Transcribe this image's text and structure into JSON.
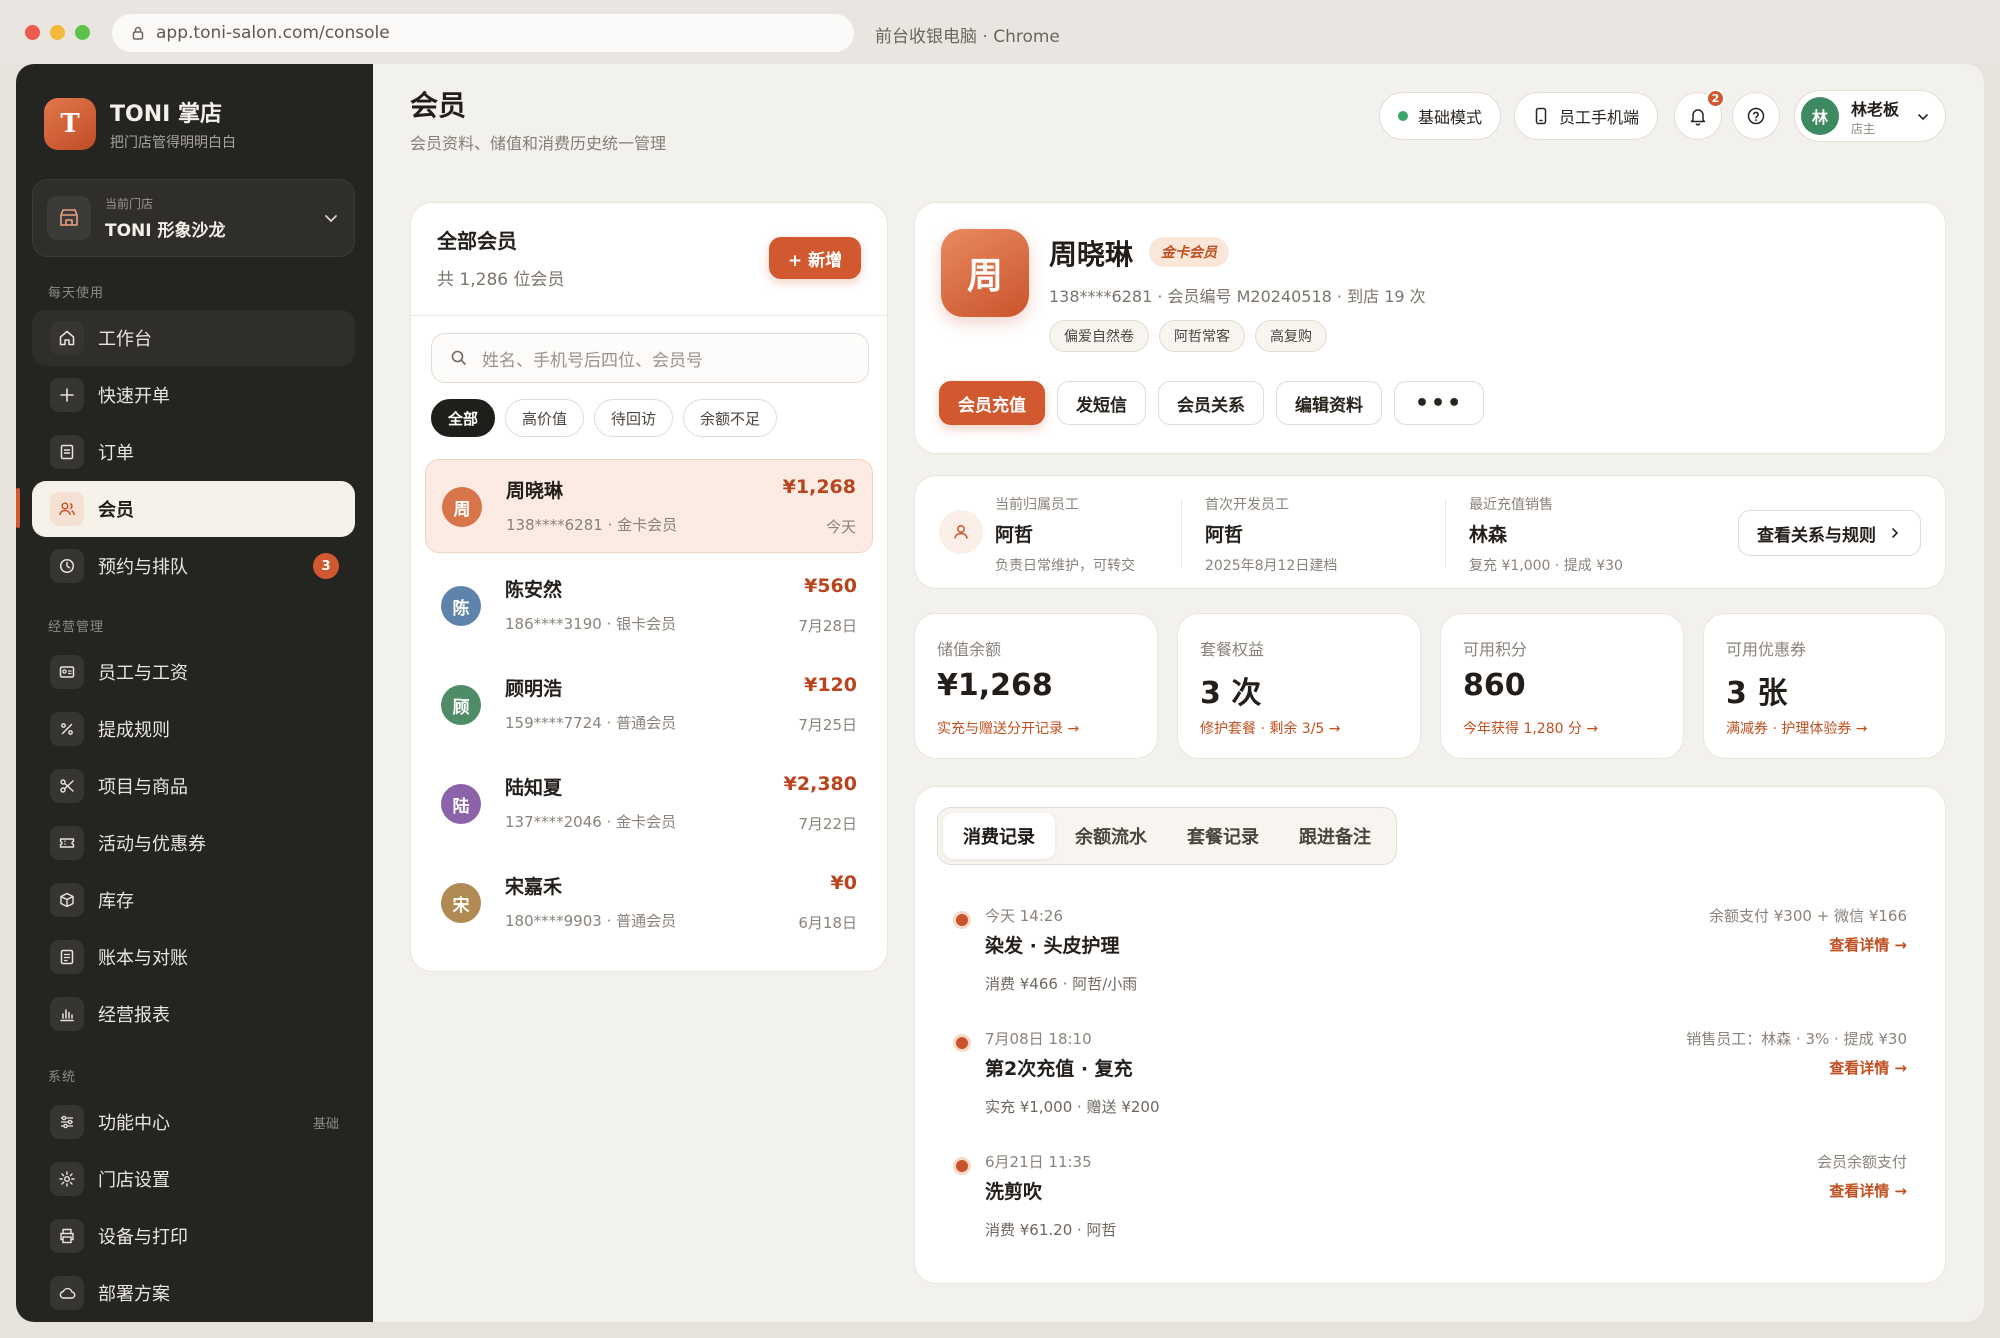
{
  "browser": {
    "url": "app.toni-salon.com/console",
    "title": "前台收银电脑 · Chrome"
  },
  "brand": {
    "logo_letter": "T",
    "name": "TONI 掌店",
    "tagline": "把门店管得明明白白"
  },
  "store": {
    "label": "当前门店",
    "name": "TONI 形象沙龙"
  },
  "nav": {
    "section_daily": "每天使用",
    "section_ops": "经营管理",
    "section_system": "系统",
    "items": {
      "workbench": "工作台",
      "quick_order": "快速开单",
      "orders": "订单",
      "members": "会员",
      "booking": "预约与排队",
      "booking_badge": "3",
      "staff_salary": "员工与工资",
      "commission": "提成规则",
      "services": "项目与商品",
      "promotions": "活动与优惠券",
      "inventory": "库存",
      "ledger": "账本与对账",
      "reports": "经营报表",
      "features": "功能中心",
      "features_tag": "基础",
      "store_settings": "门店设置",
      "devices": "设备与打印",
      "deploy": "部署方案"
    }
  },
  "header": {
    "title": "会员",
    "subtitle": "会员资料、储值和消费历史统一管理",
    "mode": "基础模式",
    "staff_mobile": "员工手机端",
    "notif_count": "2",
    "user_initial": "林",
    "user_name": "林老板",
    "user_role": "店主"
  },
  "member_list": {
    "title": "全部会员",
    "count": "共 1,286 位会员",
    "add_label": "+ 新增",
    "search_placeholder": "姓名、手机号后四位、会员号",
    "filters": [
      "全部",
      "高价值",
      "待回访",
      "余额不足"
    ],
    "members": [
      {
        "initial": "周",
        "name": "周晓琳",
        "meta": "138****6281 · 金卡会员",
        "amount": "¥1,268",
        "date": "今天",
        "color": "#d9754a"
      },
      {
        "initial": "陈",
        "name": "陈安然",
        "meta": "186****3190 · 银卡会员",
        "amount": "¥560",
        "date": "7月28日",
        "color": "#5f84ab"
      },
      {
        "initial": "顾",
        "name": "顾明浩",
        "meta": "159****7724 · 普通会员",
        "amount": "¥120",
        "date": "7月25日",
        "color": "#4e8c68"
      },
      {
        "initial": "陆",
        "name": "陆知夏",
        "meta": "137****2046 · 金卡会员",
        "amount": "¥2,380",
        "date": "7月22日",
        "color": "#8c63a8"
      },
      {
        "initial": "宋",
        "name": "宋嘉禾",
        "meta": "180****9903 · 普通会员",
        "amount": "¥0",
        "date": "6月18日",
        "color": "#b08a52"
      }
    ]
  },
  "profile": {
    "initial": "周",
    "name": "周晓琳",
    "tier": "金卡会员",
    "meta": "138****6281 · 会员编号 M20240518 · 到店 19 次",
    "tags": [
      "偏爱自然卷",
      "阿哲常客",
      "高复购"
    ],
    "actions": {
      "recharge": "会员充值",
      "sms": "发短信",
      "relation": "会员关系",
      "edit": "编辑资料",
      "more": "•••"
    }
  },
  "relations": {
    "owner": {
      "label": "当前归属员工",
      "name": "阿哲",
      "sub": "负责日常维护，可转交"
    },
    "developer": {
      "label": "首次开发员工",
      "name": "阿哲",
      "sub": "2025年8月12日建档"
    },
    "seller": {
      "label": "最近充值销售",
      "name": "林森",
      "sub": "复充 ¥1,000 · 提成 ¥30"
    },
    "button": "查看关系与规则"
  },
  "stats": [
    {
      "label": "储值余额",
      "value": "¥1,268",
      "link": "实充与赠送分开记录 →"
    },
    {
      "label": "套餐权益",
      "value": "3 次",
      "link": "修护套餐 · 剩余 3/5 →"
    },
    {
      "label": "可用积分",
      "value": "860",
      "link": "今年获得 1,280 分 →"
    },
    {
      "label": "可用优惠券",
      "value": "3 张",
      "link": "满减券 · 护理体验券 →"
    }
  ],
  "records": {
    "tabs": [
      "消费记录",
      "余额流水",
      "套餐记录",
      "跟进备注"
    ],
    "items": [
      {
        "time": "今天 14:26",
        "title": "染发 · 头皮护理",
        "meta": "消费 ¥466 · 阿哲/小雨",
        "pay": "余额支付 ¥300 + 微信 ¥166",
        "link": "查看详情 →"
      },
      {
        "time": "7月08日 18:10",
        "title": "第2次充值 · 复充",
        "meta": "实充 ¥1,000 · 赠送 ¥200",
        "pay": "销售员工：林森 · 3% · 提成 ¥30",
        "link": "查看详情 →"
      },
      {
        "time": "6月21日 11:35",
        "title": "洗剪吹",
        "meta": "消费 ¥61.20 · 阿哲",
        "pay": "会员余额支付",
        "link": "查看详情 →"
      }
    ]
  }
}
